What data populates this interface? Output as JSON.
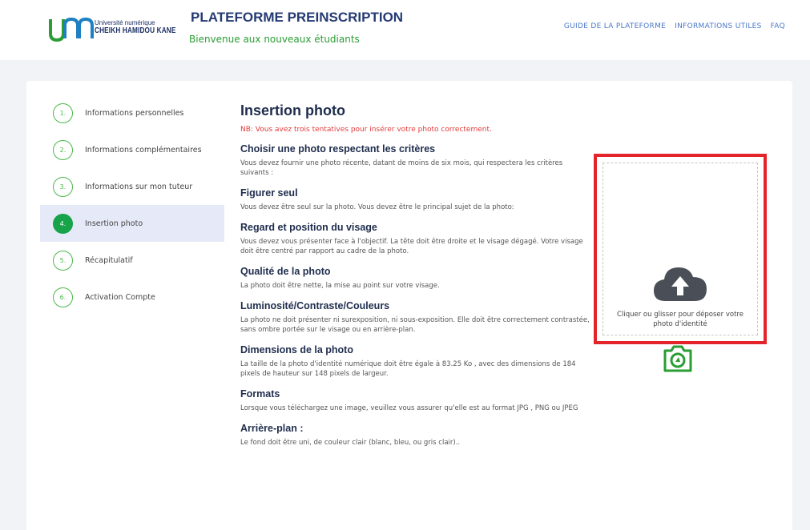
{
  "header": {
    "logo_sub": "Université numérique",
    "logo_name": "CHEIKH HAMIDOU KANE",
    "title": "PLATEFORME PREINSCRIPTION",
    "subtitle": "Bienvenue aux nouveaux étudiants",
    "nav": [
      "GUIDE DE LA PLATEFORME",
      "INFORMATIONS UTILES",
      "FAQ"
    ]
  },
  "steps": [
    {
      "number": "1.",
      "label": "Informations personnelles",
      "active": false
    },
    {
      "number": "2.",
      "label": "Informations complémentaires",
      "active": false
    },
    {
      "number": "3.",
      "label": "Informations sur mon tuteur",
      "active": false
    },
    {
      "number": "4.",
      "label": "Insertion photo",
      "active": true
    },
    {
      "number": "5.",
      "label": "Récapitulatif",
      "active": false
    },
    {
      "number": "6.",
      "label": "Activation Compte",
      "active": false
    }
  ],
  "content": {
    "title": "Insertion photo",
    "warning": "NB: Vous avez trois tentatives pour insérer votre photo correctement.",
    "sections": [
      {
        "heading": "Choisir une photo respectant les critères",
        "text": "Vous devez fournir une photo récente, datant de moins de six mois, qui respectera les critères suivants :"
      },
      {
        "heading": "Figurer seul",
        "text": "Vous devez être seul sur la photo. Vous devez être le principal sujet de la photo:"
      },
      {
        "heading": "Regard et position du visage",
        "text": "Vous devez vous présenter face à l'objectif. La tête doit être droite et le visage dégagé. Votre visage doit être centré par rapport au cadre de la photo."
      },
      {
        "heading": "Qualité de la photo",
        "text": "La photo doit être nette, la mise au point sur votre visage."
      },
      {
        "heading": "Luminosité/Contraste/Couleurs",
        "text": "La photo ne doit présenter ni surexposition, ni sous-exposition. Elle doit être correctement contrastée, sans ombre portée sur le visage ou en arrière-plan."
      },
      {
        "heading": "Dimensions de la photo",
        "text": "La taille de la photo d'identité numérique doit être égale à 83.25 Ko , avec des dimensions de 184 pixels de hauteur sur 148 pixels de largeur."
      },
      {
        "heading": "Formats",
        "text": "Lorsque vous téléchargez une image, veuillez vous assurer qu'elle est au format JPG , PNG ou JPEG"
      },
      {
        "heading": "Arrière-plan :",
        "text": "Le fond doit être uni, de couleur clair (blanc, bleu, ou gris clair).."
      }
    ]
  },
  "upload": {
    "text": "Cliquer ou glisser pour déposer votre photo d'identité",
    "icon": "cloud-upload-icon",
    "camera_icon": "camera-icon"
  },
  "colors": {
    "accent_green": "#17a34a",
    "title_blue": "#243a73",
    "warning_red": "#e23b3b",
    "highlight_red": "#e3242b",
    "nav_blue": "#4a78c9"
  }
}
